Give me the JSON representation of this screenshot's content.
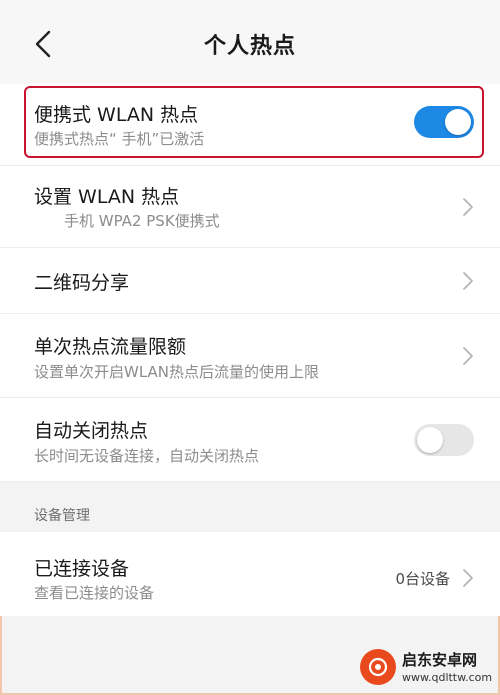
{
  "header": {
    "title": "个人热点"
  },
  "rows": [
    {
      "title": "便携式 WLAN 热点",
      "subtitle": "便携式热点“        手机”已激活",
      "toggle_on": true
    },
    {
      "title": "设置 WLAN 热点",
      "subtitle": "手机 WPA2 PSK便携式"
    },
    {
      "title": "二维码分享"
    },
    {
      "title": "单次热点流量限额",
      "subtitle": "设置单次开启WLAN热点后流量的使用上限"
    },
    {
      "title": "自动关闭热点",
      "subtitle": "长时间无设备连接，自动关闭热点",
      "toggle_on": false
    }
  ],
  "section": {
    "label": "设备管理",
    "device": {
      "title": "已连接设备",
      "subtitle": "查看已连接的设备",
      "count": "0台设备"
    }
  },
  "watermark": {
    "line1": "启东安卓网",
    "line2": "www.qdlttw.com"
  },
  "colors": {
    "accent": "#1e88e5",
    "toggle_off": "#e6e6e6",
    "highlight": "#c8142e"
  }
}
